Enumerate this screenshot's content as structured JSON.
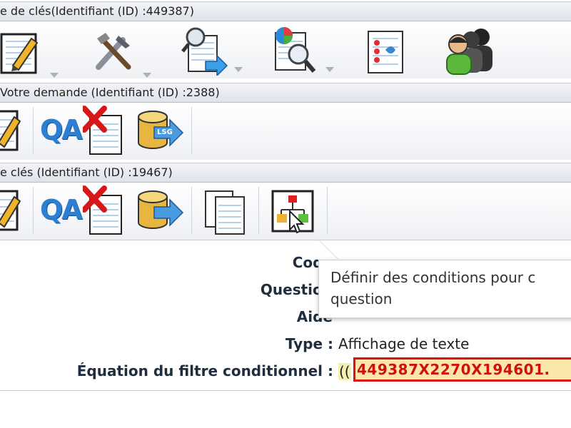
{
  "bars": {
    "survey": "e de clés(Identifiant (ID) :449387)",
    "group": "Votre demande (Identifiant (ID) :2388)",
    "question": "e clés (Identifiant (ID) :19467)"
  },
  "icons": {
    "qa": "QA",
    "lsg": "LSG"
  },
  "tooltip": {
    "line1": "Définir des conditions pour c",
    "line2": "question"
  },
  "details": {
    "code_label": "Code",
    "question_label": "Question",
    "aide_label": "Aide",
    "type_label": "Type :",
    "type_value": "Affichage de texte",
    "equation_label": "Équation du filtre conditionnel :",
    "equation_open": "((",
    "equation_value": "449387X2270X194601."
  },
  "colors": {
    "accent_red": "#d01010",
    "highlight": "#fbe7a8",
    "bar_bg": "#e6e8ee"
  }
}
